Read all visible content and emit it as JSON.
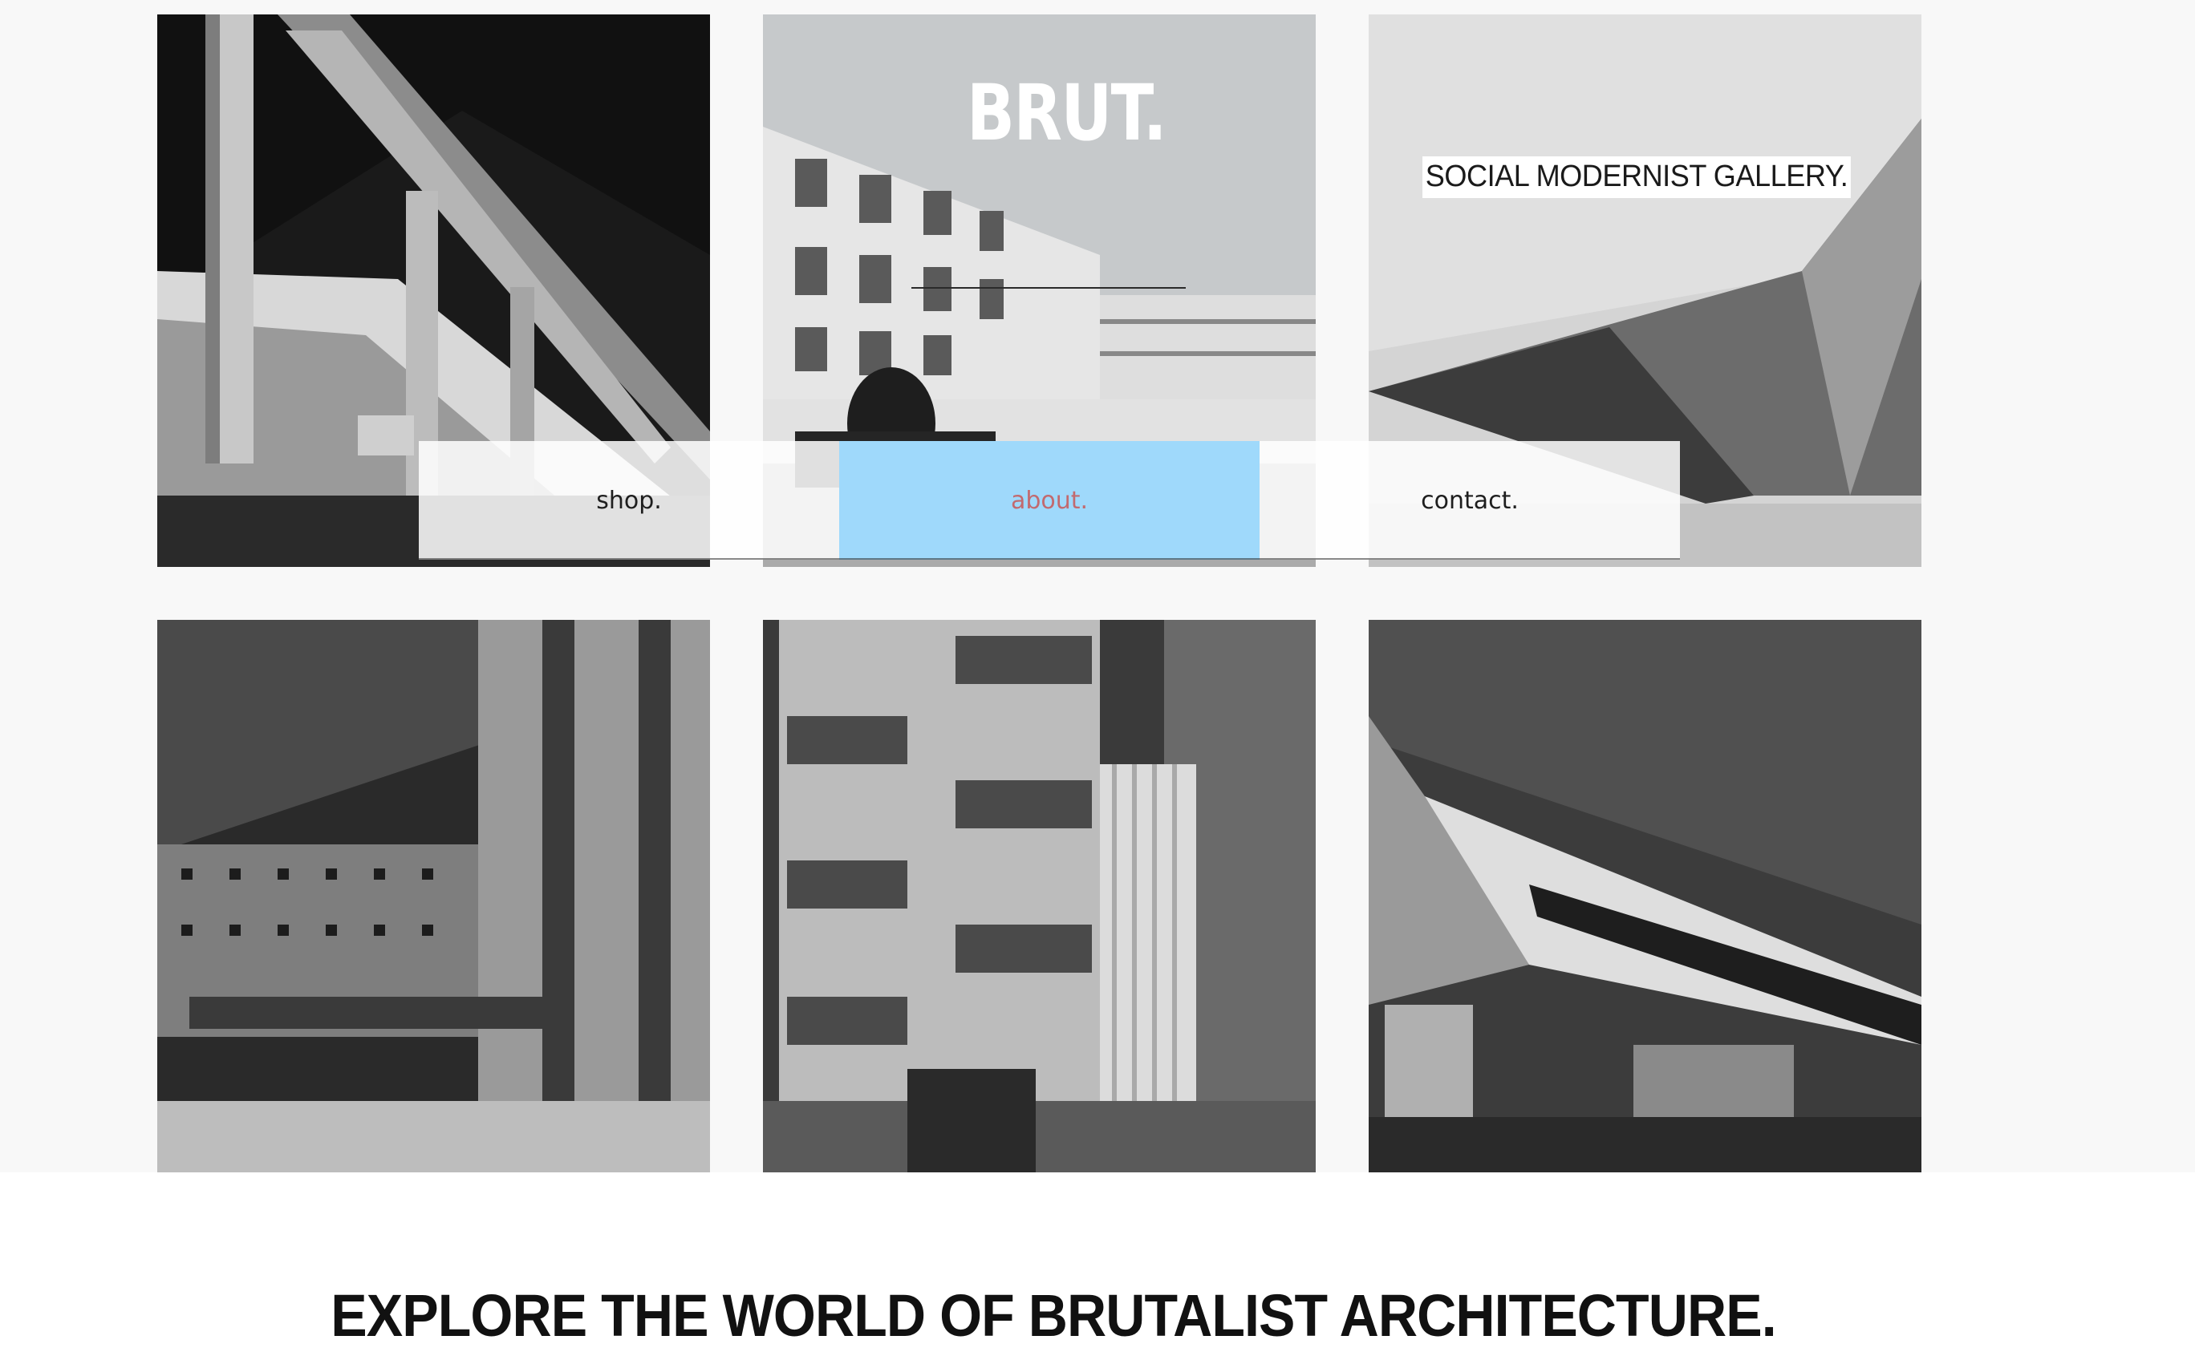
{
  "brand": {
    "logo": "BRUT.",
    "tagline": "SOCIAL MODERNIST GALLERY."
  },
  "nav": {
    "items": [
      {
        "label": "shop.",
        "active": false
      },
      {
        "label": "about.",
        "active": true
      },
      {
        "label": "contact.",
        "active": false
      }
    ],
    "active_color": "#9fd9fb",
    "active_text_color": "#c26a6f"
  },
  "gallery": {
    "tiles": [
      {
        "subject": "concrete beam facade"
      },
      {
        "subject": "housing blocks with rider"
      },
      {
        "subject": "folded concrete roof"
      },
      {
        "subject": "low concrete building with frame"
      },
      {
        "subject": "tower with brise-soleil panels"
      },
      {
        "subject": "angular sloped building"
      }
    ]
  },
  "headline": "EXPLORE THE WORLD OF BRUTALIST ARCHITECTURE."
}
